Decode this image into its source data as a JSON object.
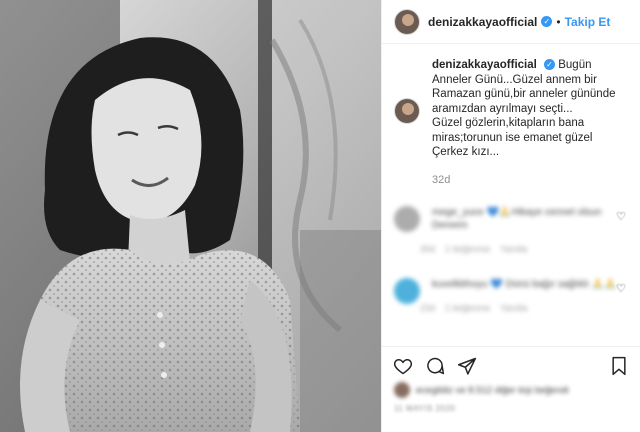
{
  "header": {
    "username": "denizakkayaofficial",
    "separator": "•",
    "follow_label": "Takip Et"
  },
  "caption": {
    "username": "denizakkayaofficial",
    "line1": "Bugün Anneler Günü...Güzel annem bir Ramazan günü,bir anneler gününde aramızdan ayrılmayı seçti...",
    "line2": "Güzel gözlerin,kitapların bana miras;torunun ise emanet güzel Çerkez kızı...",
    "time": "32d"
  },
  "comments": [
    {
      "text": "mege_yuce 💙🙏Hikaye cennet olsun Dereem",
      "time": "30d",
      "likes": "1 beğenme",
      "reply": "Yanıtla",
      "avatar_color": "#9e9e9e"
    },
    {
      "text": "kuvelkbhoyu 💙 Dünü bağır sağlıklı 🙏🙏",
      "time": "23d",
      "likes": "1 beğenme",
      "reply": "Yanıtla",
      "avatar_color": "#2fa4d6"
    }
  ],
  "likes": {
    "text": "ecegildiz ve 8.512 diğer kişi beğendi"
  },
  "date": "11 MAYIS 2020",
  "icons": {
    "verified": "verified-badge-icon",
    "like": "heart-icon",
    "comment": "comment-bubble-icon",
    "share": "paper-plane-icon",
    "save": "bookmark-icon"
  },
  "colors": {
    "link_blue": "#3897f0",
    "muted": "#8e8e8e",
    "text": "#262626"
  }
}
